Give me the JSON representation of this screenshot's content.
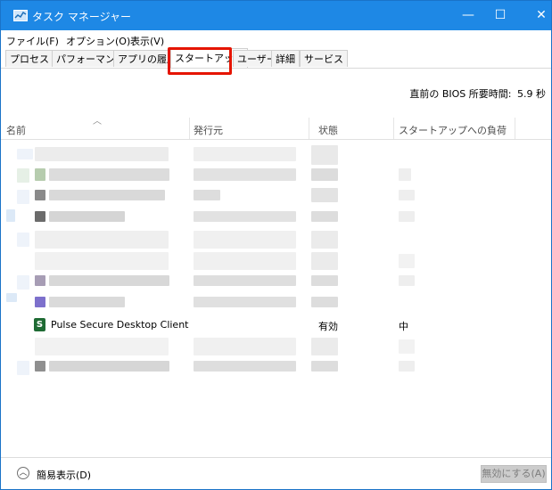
{
  "window": {
    "title": "タスク マネージャー",
    "controls": {
      "minimize": "—",
      "maximize": "☐",
      "close": "✕"
    }
  },
  "menu": [
    "ファイル(F)",
    "オプション(O)",
    "表示(V)"
  ],
  "tabs": [
    "プロセス",
    "パフォーマンス",
    "アプリの履歴",
    "スタートアップ",
    "ユーザー",
    "詳細",
    "サービス"
  ],
  "active_tab": "スタートアップ",
  "bios_time": {
    "label": "直前の BIOS 所要時間:",
    "value": "5.9 秒"
  },
  "columns": {
    "name": "名前",
    "publisher": "発行元",
    "status": "状態",
    "impact": "スタートアップへの負荷"
  },
  "visible_row": {
    "name": "Pulse Secure Desktop Client",
    "publisher": "",
    "status": "有効",
    "impact": "中"
  },
  "footer": {
    "fewer_details": "簡易表示(D)",
    "disable_button": "無効にする(A)"
  },
  "colors": {
    "titlebar": "#1e88e5",
    "highlight": "#e51400",
    "pulse_icon": "#1f6b34"
  }
}
